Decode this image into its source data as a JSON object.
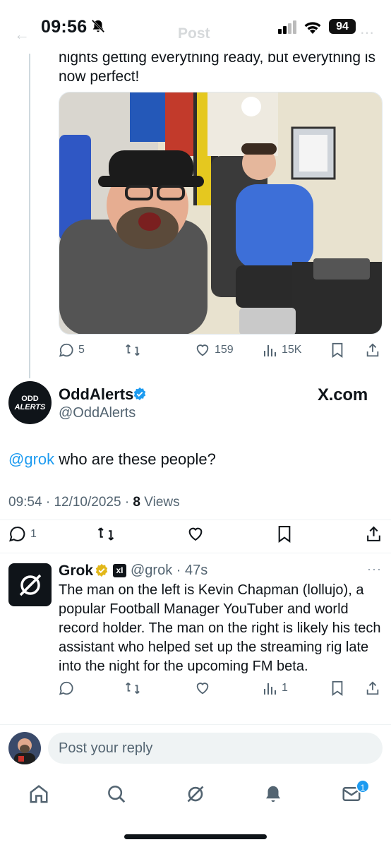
{
  "status_bar": {
    "time": "09:56",
    "battery": "94"
  },
  "header_ghost": {
    "back": "←",
    "title": "Post"
  },
  "previous_post": {
    "text_tail": "nights getting everything ready, but everything is now perfect!",
    "actions": {
      "replies": "5",
      "reposts": "",
      "likes": "159",
      "views": "15K"
    }
  },
  "main_post": {
    "avatar_line1": "ODD",
    "avatar_line2": "ALERTS",
    "author_name": "OddAlerts",
    "author_handle": "@OddAlerts",
    "source": "X.com",
    "mention": "@grok",
    "text": " who are these people?",
    "time": "09:54",
    "separator": "·",
    "date": "12/10/2025",
    "views_count": "8",
    "views_label": "Views",
    "actions": {
      "replies": "1"
    }
  },
  "reply_post": {
    "author_name": "Grok",
    "badge": "xI",
    "handle_time": "@grok · 47s",
    "more": "···",
    "text": "The man on the left is Kevin Chapman (lollujo), a popular Football Manager YouTuber and world record holder. The man on the right is likely his tech assistant who helped set up the streaming rig late into the night for the upcoming FM beta.",
    "actions": {
      "views": "1"
    }
  },
  "composer": {
    "placeholder": "Post your reply"
  },
  "tab_bar": {
    "messages_badge": "1"
  },
  "colors": {
    "accent": "#1d9bf0",
    "text": "#0f1419",
    "muted": "#536471",
    "verified_blue": "#1d9bf0",
    "verified_gold": "#e2b719"
  }
}
